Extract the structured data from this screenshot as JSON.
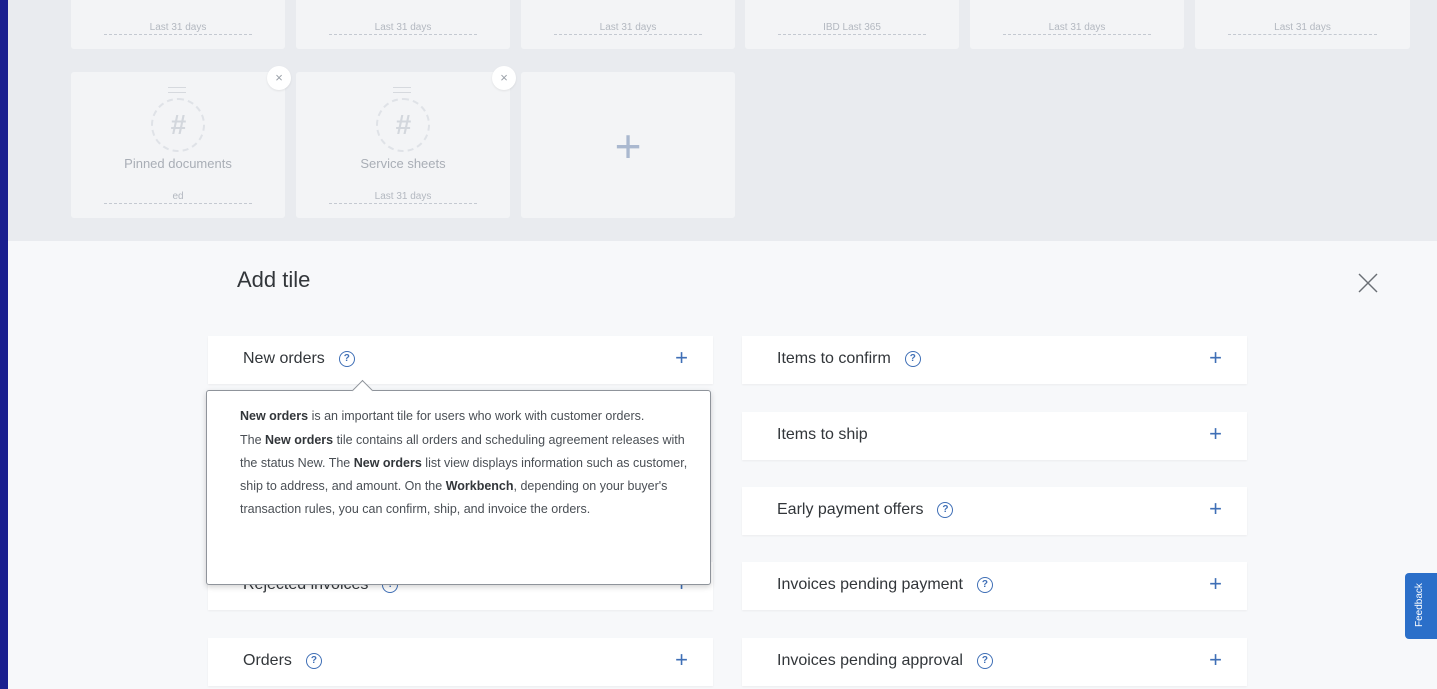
{
  "dashboard": {
    "top_tiles": [
      {
        "sublabel": "Last 31 days"
      },
      {
        "sublabel": "Last 31 days"
      },
      {
        "sublabel": "Last 31 days"
      },
      {
        "sublabel": "IBD Last 365"
      },
      {
        "sublabel": "Last 31 days"
      },
      {
        "sublabel": "Last 31 days"
      }
    ],
    "tiles": [
      {
        "name": "Pinned documents",
        "sublabel": "ed",
        "icon": "hash-icon"
      },
      {
        "name": "Service sheets",
        "sublabel": "Last 31 days",
        "icon": "hash-icon"
      }
    ],
    "close_glyph": "×",
    "add_glyph": "+"
  },
  "add_tile": {
    "title": "Add tile",
    "left_rows": [
      {
        "label": "New orders",
        "help": true
      },
      {
        "label": "Rejected invoices",
        "help": true
      },
      {
        "label": "Orders",
        "help": true
      }
    ],
    "right_rows": [
      {
        "label": "Items to confirm",
        "help": true
      },
      {
        "label": "Items to ship",
        "help": false
      },
      {
        "label": "Early payment offers",
        "help": true
      },
      {
        "label": "Invoices pending payment",
        "help": true
      },
      {
        "label": "Invoices pending approval",
        "help": true
      }
    ],
    "help_glyph": "?",
    "add_glyph": "+"
  },
  "tooltip": {
    "p1_b1": "New orders",
    "p1_t1": " is an important tile for users who work with customer orders.",
    "p2_t1": "The ",
    "p2_b1": "New orders",
    "p2_t2": " tile contains all orders and scheduling agreement releases with the status New. The ",
    "p2_b2": "New orders",
    "p2_t3": " list view displays information such as customer, ship to address, and amount. On the ",
    "p2_b3": "Workbench",
    "p2_t4": ", depending on your buyer's transaction rules, you can confirm, ship, and invoice the orders."
  },
  "feedback": {
    "label": "Feedback"
  },
  "colors": {
    "accent": "#3f6fb6",
    "frame": "#1a1f8f",
    "feedback": "#2b6fc9"
  }
}
